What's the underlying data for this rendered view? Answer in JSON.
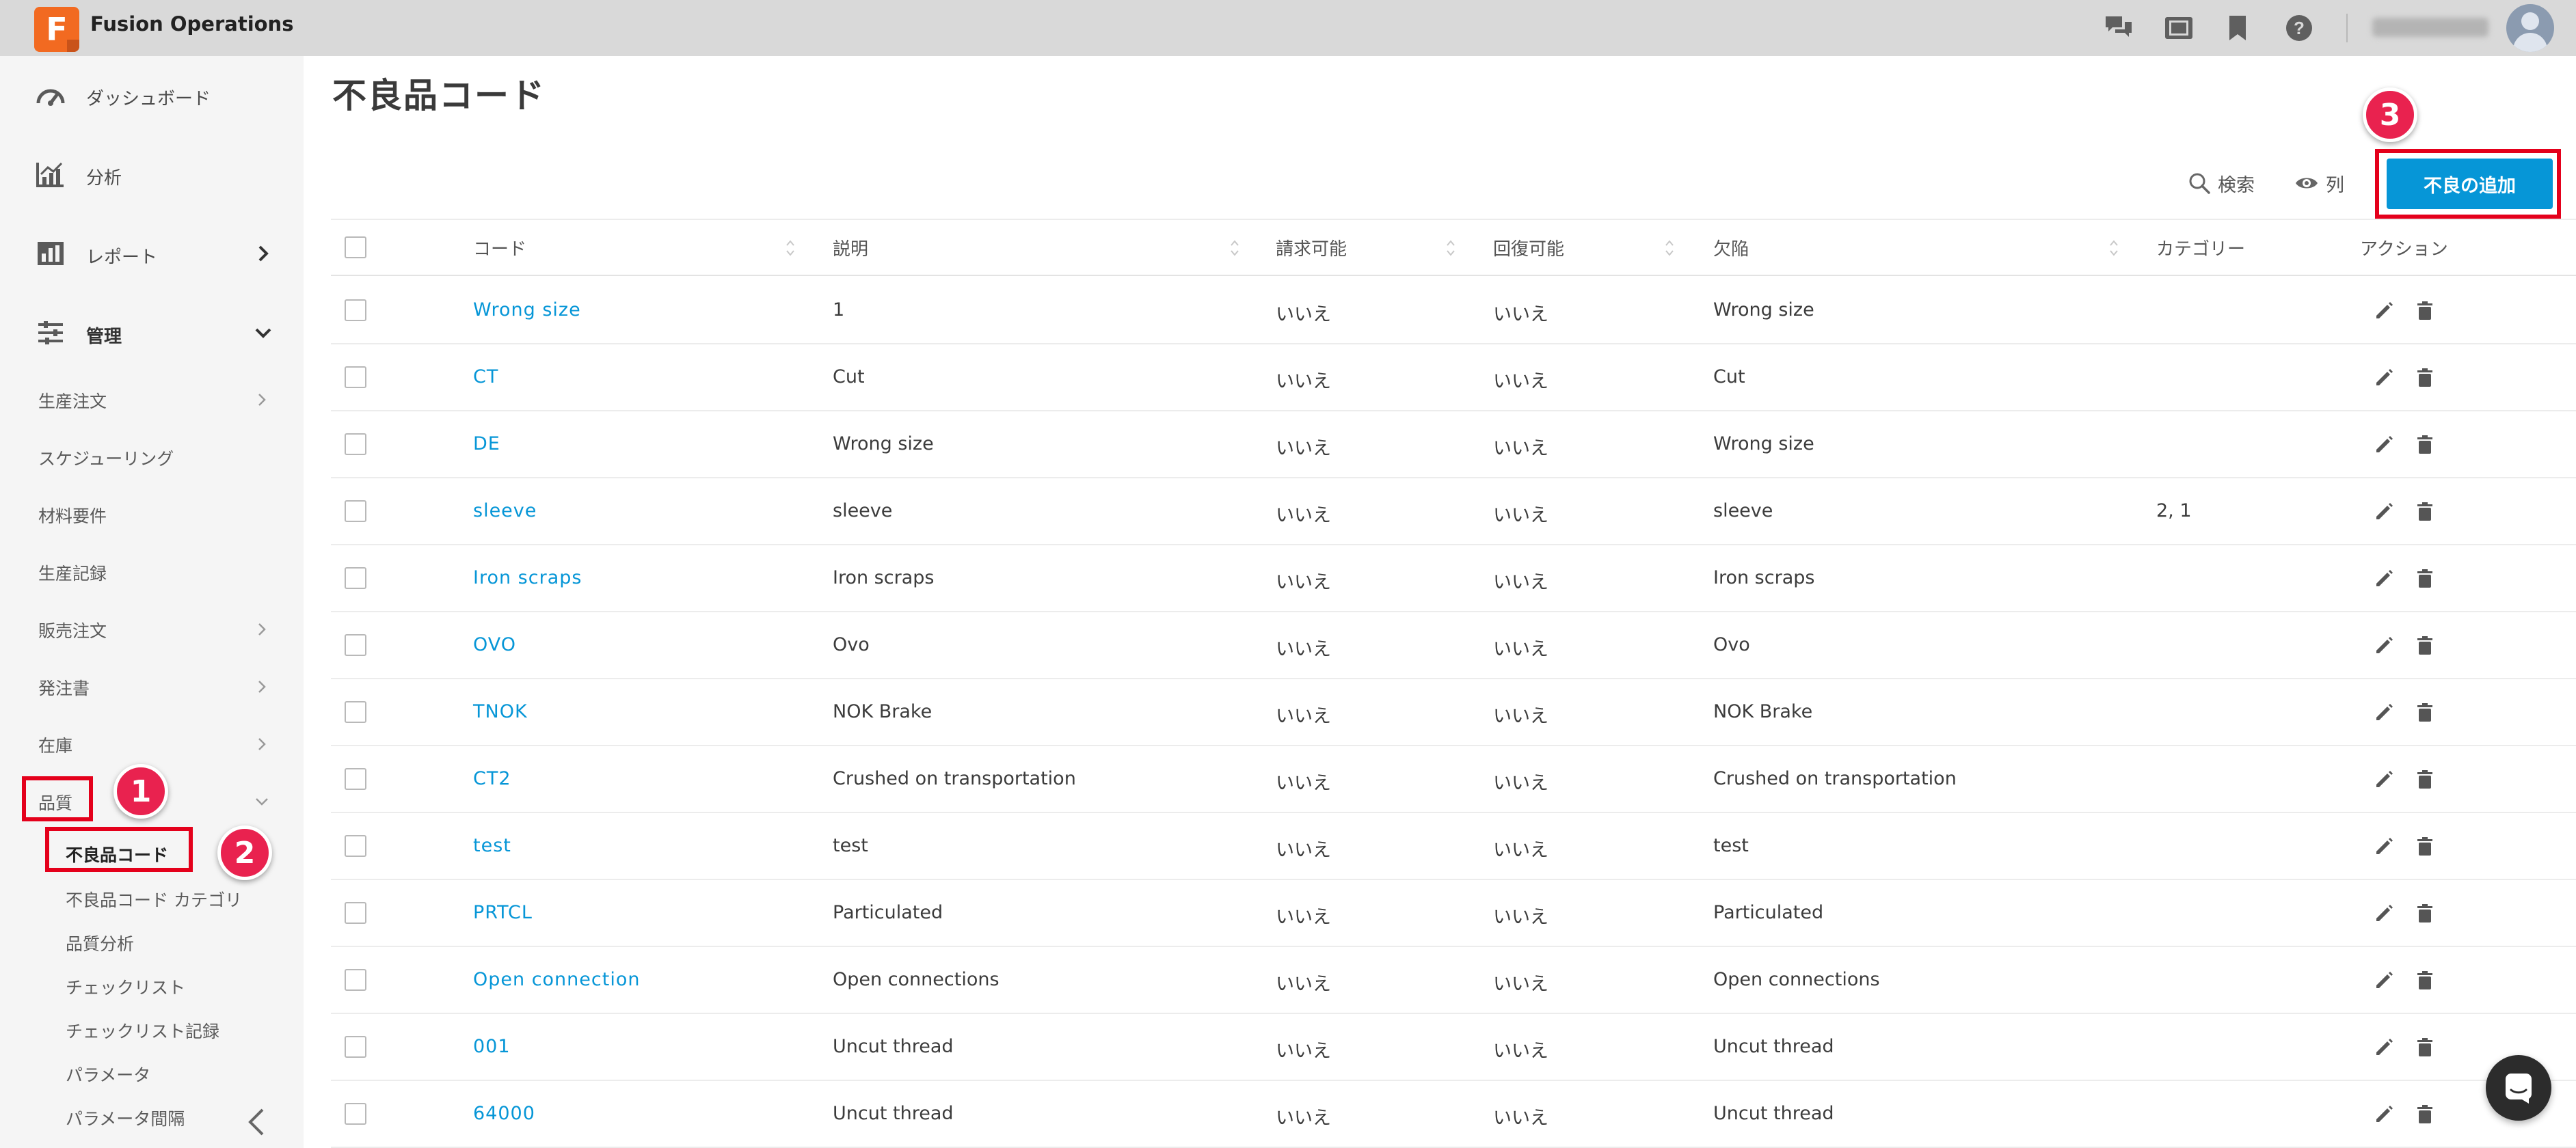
{
  "app": {
    "logo_letter": "F",
    "title": "Fusion Operations"
  },
  "topbar": {
    "icons": [
      "chat-icon",
      "tablet-icon",
      "bookmark-icon",
      "help-icon"
    ],
    "user_name": "Welcome User",
    "accent": "#0696d7"
  },
  "sidebar": {
    "main_items": [
      {
        "label": "ダッシュボード",
        "icon": "dashboard-icon"
      },
      {
        "label": "分析",
        "icon": "analytics-icon"
      },
      {
        "label": "レポート",
        "icon": "report-icon"
      },
      {
        "label": "管理",
        "icon": "settings-sliders-icon"
      }
    ],
    "sub_items": [
      {
        "label": "生産注文"
      },
      {
        "label": "スケジューリング"
      },
      {
        "label": "材料要件"
      },
      {
        "label": "生産記録"
      },
      {
        "label": "販売注文"
      },
      {
        "label": "発注書"
      },
      {
        "label": "在庫"
      },
      {
        "label": "品質"
      }
    ],
    "quality_items": [
      {
        "label": "不良品コード"
      },
      {
        "label": "不良品コード カテゴリ"
      },
      {
        "label": "品質分析"
      },
      {
        "label": "チェックリスト"
      },
      {
        "label": "チェックリスト記録"
      },
      {
        "label": "パラメータ"
      },
      {
        "label": "パラメータ間隔"
      }
    ]
  },
  "page": {
    "title": "不良品コード"
  },
  "toolbar": {
    "search_label": "検索",
    "columns_label": "列",
    "add_label": "不良の追加"
  },
  "table": {
    "headers": {
      "code": "コード",
      "description": "説明",
      "billable": "請求可能",
      "recoverable": "回復可能",
      "defect": "欠陥",
      "category": "カテゴリー",
      "actions": "アクション"
    },
    "rows": [
      {
        "code": "Wrong size",
        "description": "1",
        "billable": "いいえ",
        "recoverable": "いいえ",
        "defect": "Wrong size",
        "category": ""
      },
      {
        "code": "CT",
        "description": "Cut",
        "billable": "いいえ",
        "recoverable": "いいえ",
        "defect": "Cut",
        "category": ""
      },
      {
        "code": "DE",
        "description": "Wrong size",
        "billable": "いいえ",
        "recoverable": "いいえ",
        "defect": "Wrong size",
        "category": ""
      },
      {
        "code": "sleeve",
        "description": "sleeve",
        "billable": "いいえ",
        "recoverable": "いいえ",
        "defect": "sleeve",
        "category": "2, 1"
      },
      {
        "code": "Iron scraps",
        "description": "Iron scraps",
        "billable": "いいえ",
        "recoverable": "いいえ",
        "defect": "Iron scraps",
        "category": ""
      },
      {
        "code": "OVO",
        "description": "Ovo",
        "billable": "いいえ",
        "recoverable": "いいえ",
        "defect": "Ovo",
        "category": ""
      },
      {
        "code": "TNOK",
        "description": "NOK Brake",
        "billable": "いいえ",
        "recoverable": "いいえ",
        "defect": "NOK Brake",
        "category": ""
      },
      {
        "code": "CT2",
        "description": "Crushed on transportation",
        "billable": "いいえ",
        "recoverable": "いいえ",
        "defect": "Crushed on transportation",
        "category": ""
      },
      {
        "code": "test",
        "description": "test",
        "billable": "いいえ",
        "recoverable": "いいえ",
        "defect": "test",
        "category": ""
      },
      {
        "code": "PRTCL",
        "description": "Particulated",
        "billable": "いいえ",
        "recoverable": "いいえ",
        "defect": "Particulated",
        "category": ""
      },
      {
        "code": "Open connection",
        "description": "Open connections",
        "billable": "いいえ",
        "recoverable": "いいえ",
        "defect": "Open connections",
        "category": ""
      },
      {
        "code": "001",
        "description": "Uncut thread",
        "billable": "いいえ",
        "recoverable": "いいえ",
        "defect": "Uncut thread",
        "category": ""
      },
      {
        "code": "64000",
        "description": "Uncut thread",
        "billable": "いいえ",
        "recoverable": "いいえ",
        "defect": "Uncut thread",
        "category": ""
      }
    ]
  },
  "annotations": {
    "badge1": "1",
    "badge2": "2",
    "badge3": "3",
    "highlight_color": "#e4001b",
    "badge_color": "#e9224f"
  }
}
